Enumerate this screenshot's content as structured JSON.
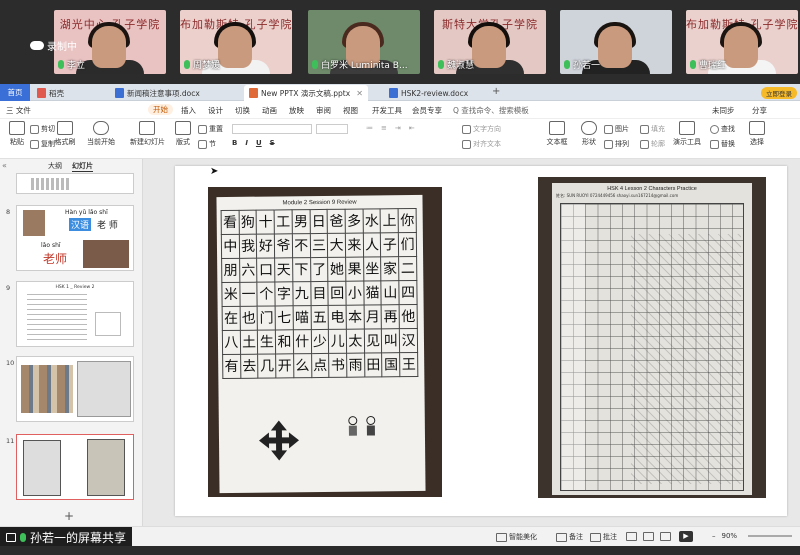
{
  "meeting": {
    "recording_label": "录制中",
    "participants": [
      {
        "name": "李立",
        "banner": "湖光中心 孔子学院",
        "bg": "#e9c2c2",
        "hair": "#1c1410",
        "shirt": "#2b2b2b"
      },
      {
        "name": "周梦媛",
        "banner": "布加勒斯特 孔子学院",
        "bg": "#ecd0cc",
        "hair": "#15100e",
        "shirt": "#f2f2f2"
      },
      {
        "name": "白罗米 Luminita B...",
        "banner": "",
        "bg": "#6e8a6a",
        "hair": "#4a2a1e",
        "shirt": "#3c3c3c"
      },
      {
        "name": "魏淑慧",
        "banner": "斯特大学孔子学院",
        "bg": "#e4c8c4",
        "hair": "#140f0c",
        "shirt": "#2f2f2f"
      },
      {
        "name": "孙若一",
        "banner": "",
        "bg": "#cfd3da",
        "hair": "#1a1410",
        "shirt": "#222222"
      },
      {
        "name": "曹瑞红",
        "banner": "布加勒斯特 孔子学院",
        "bg": "#ead1cd",
        "hair": "#1c1410",
        "shirt": "#f4f4f4"
      }
    ]
  },
  "tabs": {
    "home": "首页",
    "items": [
      {
        "label": "稻壳",
        "color": "#e05a4f"
      },
      {
        "label": "新闻稿注意事项.docx",
        "color": "#3b6fd4"
      },
      {
        "label": "New PPTX 演示文稿.pptx",
        "color": "#e06a38"
      },
      {
        "label": "HSK2-review.docx",
        "color": "#3b6fd4"
      }
    ],
    "login": "立即登录"
  },
  "menubar": {
    "file": "三 文件",
    "items": [
      "开始",
      "插入",
      "设计",
      "切换",
      "动画",
      "放映",
      "审阅",
      "视图",
      "开发工具",
      "会员专享"
    ],
    "search": "Q 查找命令、搜索模板",
    "right": [
      "未同步",
      "分享"
    ]
  },
  "ribbon": {
    "paste": "粘贴",
    "cut": "剪切",
    "copy": "复制",
    "format_painter": "格式刷",
    "play_from_current": "当前开始",
    "new_slide": "新建幻灯片",
    "layout": "版式",
    "section": "节",
    "reset": "重置",
    "text_box": "文本框",
    "shape": "形状",
    "arrange": "排列",
    "picture": "图片",
    "fill": "填充",
    "outline": "轮廓",
    "presenter_tools": "演示工具",
    "find": "查找",
    "replace": "替换",
    "select": "选择",
    "text_direction": "文字方向",
    "align_text": "对齐文本"
  },
  "panel": {
    "tabs": [
      "大纲",
      "幻灯片"
    ],
    "slide_numbers": [
      "8",
      "9",
      "10",
      "11"
    ],
    "slide8_text": [
      "Hàn",
      "yǔ",
      "lǎo",
      "shī",
      "汉语",
      "老 师",
      "lǎo",
      "shī",
      "老师"
    ],
    "slide9_title": "HSK 1 _ Review 2",
    "add": "+"
  },
  "slide": {
    "left_title": "Module 2    Session 9 Review",
    "grid": [
      [
        "看",
        "狗",
        "十",
        "工",
        "男",
        "日",
        "爸",
        "多",
        "水",
        "上",
        "你"
      ],
      [
        "中",
        "我",
        "好",
        "爷",
        "不",
        "三",
        "大",
        "来",
        "人",
        "子",
        "们"
      ],
      [
        "朋",
        "六",
        "口",
        "天",
        "下",
        "了",
        "她",
        "果",
        "坐",
        "家",
        "二"
      ],
      [
        "米",
        "一",
        "个",
        "字",
        "九",
        "目",
        "回",
        "小",
        "猫",
        "山",
        "四"
      ],
      [
        "在",
        "也",
        "门",
        "七",
        "喵",
        "五",
        "电",
        "本",
        "月",
        "再",
        "他"
      ],
      [
        "八",
        "土",
        "生",
        "和",
        "什",
        "少",
        "儿",
        "太",
        "见",
        "叫",
        "汉"
      ],
      [
        "有",
        "去",
        "几",
        "开",
        "么",
        "点",
        "书",
        "雨",
        "田",
        "国",
        "王"
      ]
    ],
    "right_title": "HSK 4    Lesson 2    Characters Practice",
    "right_header": "姓名:    SUN RUOYI    0724449456    shaoyi.sun167214@gmail.com"
  },
  "status": {
    "smart_beautify": "智能美化",
    "notes": "备注",
    "comments": "批注",
    "zoom": "90%",
    "share_label": "孙若一的屏幕共享"
  }
}
